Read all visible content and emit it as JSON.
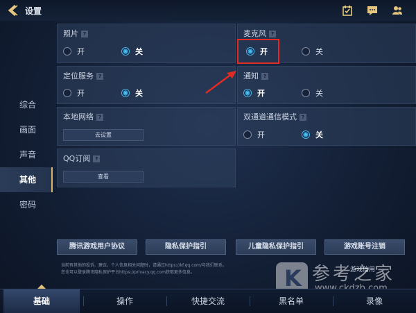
{
  "header": {
    "title": "设置"
  },
  "sidebar": {
    "items": [
      {
        "label": "综合"
      },
      {
        "label": "画面"
      },
      {
        "label": "声音"
      },
      {
        "label": "其他"
      },
      {
        "label": "密码"
      }
    ],
    "active_index": 3
  },
  "settings": {
    "photo": {
      "title": "照片",
      "on": "开",
      "off": "关",
      "selected": "off"
    },
    "mic": {
      "title": "麦克风",
      "on": "开",
      "off": "关",
      "selected": "on"
    },
    "location": {
      "title": "定位服务",
      "on": "开",
      "off": "关",
      "selected": "off"
    },
    "notify": {
      "title": "通知",
      "on": "开",
      "off": "关",
      "selected": "on"
    },
    "local_network": {
      "title": "本地网络",
      "button": "去设置"
    },
    "dual_channel": {
      "title": "双通道通信模式",
      "on": "开",
      "off": "关",
      "selected": "off"
    },
    "qq_sub": {
      "title": "QQ订阅",
      "button": "查看"
    }
  },
  "links": [
    {
      "label": "腾讯游戏用户协议"
    },
    {
      "label": "隐私保护指引"
    },
    {
      "label": "儿童隐私保护指引"
    },
    {
      "label": "游戏账号注销"
    }
  ],
  "footnote": {
    "line1": "当前有其他的投诉、建议，个人信息相关问题时，请通过https://kf.qq.com/与我们联系。",
    "line2": "您也可以登录腾讯隐私保护平台https://privacy.qq.com获取更多信息。",
    "partial": "游戏信用"
  },
  "tabs": [
    {
      "label": "基础"
    },
    {
      "label": "操作"
    },
    {
      "label": "快捷交流"
    },
    {
      "label": "黑名单"
    },
    {
      "label": "录像"
    }
  ],
  "watermark": {
    "name": "参考之家",
    "url": "www.ckdzb.com",
    "logo_letter": "K"
  },
  "help_glyph": "?",
  "colors": {
    "accent": "#4bb6e8",
    "highlight": "#e12b24",
    "gold": "#e1c07a"
  }
}
